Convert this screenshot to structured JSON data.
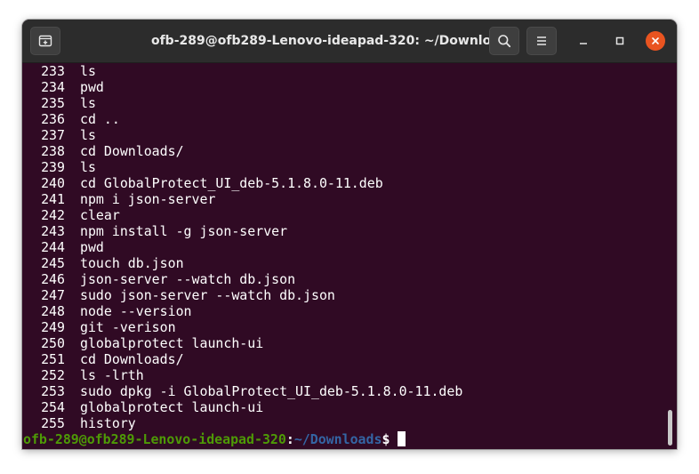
{
  "window": {
    "title": "ofb-289@ofb289-Lenovo-ideapad-320: ~/Downloads"
  },
  "icons": {
    "new_tab": "new-tab-icon",
    "search": "search-icon",
    "menu": "hamburger-menu-icon",
    "minimize": "minimize-icon",
    "maximize": "maximize-icon",
    "close": "close-icon"
  },
  "colors": {
    "terminal_bg": "#300a24",
    "titlebar_bg": "#2c2c2c",
    "close_accent": "#e95420",
    "prompt_user": "#4e9a06",
    "prompt_path": "#3465a4"
  },
  "history": [
    {
      "num": "233",
      "cmd": "ls"
    },
    {
      "num": "234",
      "cmd": "pwd"
    },
    {
      "num": "235",
      "cmd": "ls"
    },
    {
      "num": "236",
      "cmd": "cd .."
    },
    {
      "num": "237",
      "cmd": "ls"
    },
    {
      "num": "238",
      "cmd": "cd Downloads/"
    },
    {
      "num": "239",
      "cmd": "ls"
    },
    {
      "num": "240",
      "cmd": "cd GlobalProtect_UI_deb-5.1.8.0-11.deb"
    },
    {
      "num": "241",
      "cmd": "npm i json-server"
    },
    {
      "num": "242",
      "cmd": "clear"
    },
    {
      "num": "243",
      "cmd": "npm install -g json-server"
    },
    {
      "num": "244",
      "cmd": "pwd"
    },
    {
      "num": "245",
      "cmd": "touch db.json"
    },
    {
      "num": "246",
      "cmd": "json-server --watch db.json"
    },
    {
      "num": "247",
      "cmd": "sudo json-server --watch db.json"
    },
    {
      "num": "248",
      "cmd": "node --version"
    },
    {
      "num": "249",
      "cmd": "git -verison"
    },
    {
      "num": "250",
      "cmd": "globalprotect launch-ui"
    },
    {
      "num": "251",
      "cmd": "cd Downloads/"
    },
    {
      "num": "252",
      "cmd": "ls -lrth"
    },
    {
      "num": "253",
      "cmd": "sudo dpkg -i GlobalProtect_UI_deb-5.1.8.0-11.deb"
    },
    {
      "num": "254",
      "cmd": "globalprotect launch-ui"
    },
    {
      "num": "255",
      "cmd": "history"
    }
  ],
  "prompt": {
    "user_host": "ofb-289@ofb289-Lenovo-ideapad-320",
    "separator": ":",
    "path": "~/Downloads",
    "symbol": "$"
  }
}
